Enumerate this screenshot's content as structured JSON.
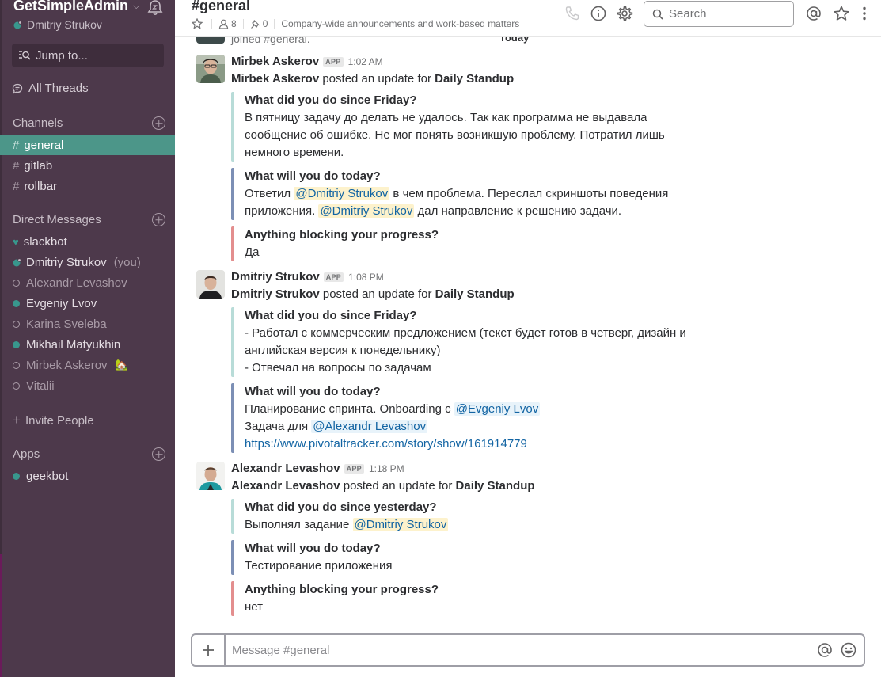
{
  "sidebar": {
    "team_name": "GetSimpleAdmin",
    "current_user": "Dmitriy Strukov",
    "jump_to": "Jump to...",
    "all_threads": "All Threads",
    "channels_heading": "Channels",
    "channels": [
      {
        "name": "general",
        "active": true
      },
      {
        "name": "gitlab",
        "active": false
      },
      {
        "name": "rollbar",
        "active": false
      }
    ],
    "dm_heading": "Direct Messages",
    "dms": [
      {
        "name": "slackbot",
        "status": "bot"
      },
      {
        "name": "Dmitriy Strukov",
        "status": "self",
        "suffix": "(you)"
      },
      {
        "name": "Alexandr Levashov",
        "status": "away"
      },
      {
        "name": "Evgeniy Lvov",
        "status": "online"
      },
      {
        "name": "Karina Sveleba",
        "status": "away"
      },
      {
        "name": "Mikhail Matyukhin",
        "status": "online"
      },
      {
        "name": "Mirbek Askerov",
        "status": "away",
        "emoji": "🏡"
      },
      {
        "name": "Vitalii",
        "status": "away"
      }
    ],
    "invite": "Invite People",
    "apps_heading": "Apps",
    "apps": [
      {
        "name": "geekbot",
        "status": "online"
      }
    ]
  },
  "header": {
    "channel": "#general",
    "members": "8",
    "pins": "0",
    "topic": "Company-wide announcements and work-based matters",
    "search_placeholder": "Search"
  },
  "feed": {
    "joined_text": "joined #general.",
    "day_divider": "Today",
    "messages": [
      {
        "sender": "Mirbek Askerov",
        "badge": "APP",
        "time": "1:02 AM",
        "intro_name": "Mirbek Askerov",
        "intro_mid": " posted an update for ",
        "intro_target": "Daily Standup",
        "q1": "What did you do since Friday?",
        "a1": "В пятницу задачу до делать не удалось. Так как программа не выдавала сообщение об ошибке. Не мог понять возникшую проблему. Потратил лишь немного времени.",
        "q2": "What will you do today?",
        "a2_p1": "Ответил ",
        "a2_m1": "@Dmitriy Strukov",
        "a2_p2": " в чем проблема. Переслал скриншоты поведения приложения. ",
        "a2_m2": "@Dmitriy Strukov",
        "a2_p3": " дал направление к решению задачи.",
        "q3": "Anything blocking your progress?",
        "a3": "Да"
      },
      {
        "sender": "Dmitriy Strukov",
        "badge": "APP",
        "time": "1:08 PM",
        "intro_name": "Dmitriy Strukov",
        "intro_mid": " posted an update for ",
        "intro_target": "Daily Standup",
        "q1": "What did you do since Friday?",
        "a1_l1": "- Работал с коммерческим предложением (текст будет готов в четверг, дизайн и английская версия к понедельнику)",
        "a1_l2": "- Отвечал на вопросы по задачам",
        "q2": "What will you do today?",
        "a2_p1": "Планирование спринта. Onboarding с ",
        "a2_m1": "@Evgeniy Lvov",
        "a2_p2": "Задача для ",
        "a2_m2": "@Alexandr Levashov",
        "a2_link": "https://www.pivotaltracker.com/story/show/161914779"
      },
      {
        "sender": "Alexandr Levashov",
        "badge": "APP",
        "time": "1:18 PM",
        "intro_name": "Alexandr Levashov",
        "intro_mid": " posted an update for ",
        "intro_target": "Daily Standup",
        "q1": "What did you do since yesterday?",
        "a1_p1": "Выполнял задание ",
        "a1_m1": "@Dmitriy Strukov",
        "q2": "What will you do today?",
        "a2": "Тестирование приложения",
        "q3": "Anything blocking your progress?",
        "a3": "нет"
      }
    ]
  },
  "composer": {
    "placeholder": "Message #general"
  }
}
